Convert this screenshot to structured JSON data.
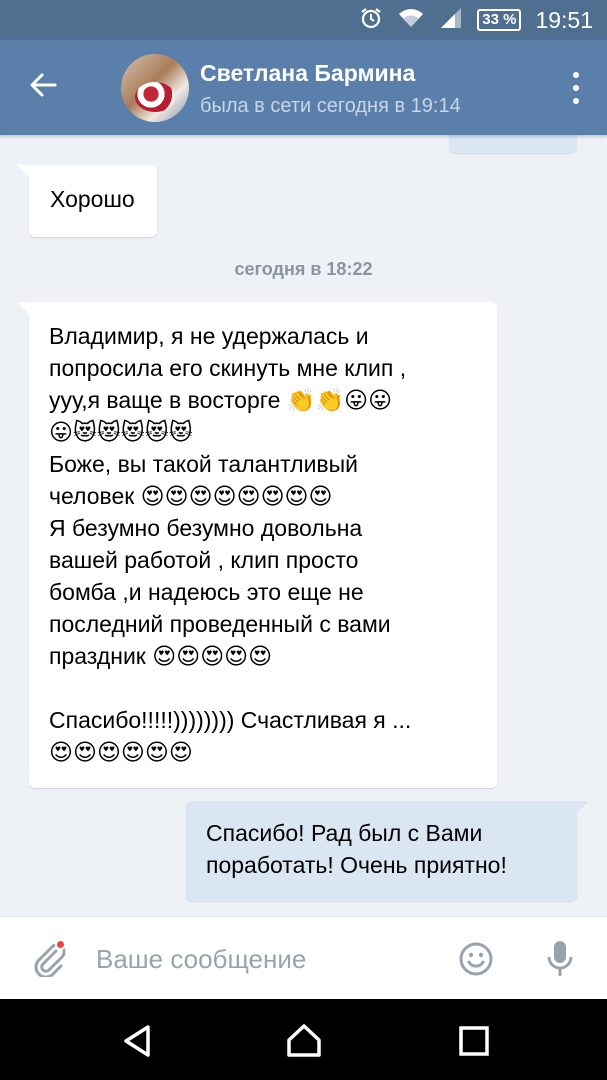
{
  "status_bar": {
    "alarm_icon": "alarm-icon",
    "wifi_icon": "wifi-icon",
    "signal_icon": "signal-icon",
    "battery_percent": "33 %",
    "time": "19:51"
  },
  "header": {
    "contact_name": "Светлана Бармина",
    "contact_status": "была в сети сегодня в 19:14",
    "colors": {
      "header_bg": "#5a7fab",
      "status_bar_bg": "#4f6f91"
    }
  },
  "chat": {
    "date_separator": "сегодня в 18:22",
    "messages": [
      {
        "direction": "in",
        "text": "Хорошо"
      },
      {
        "direction": "in",
        "text": "Владимир, я не удержалась и\nпопросила его скинуть мне клип ,\nууу,я ваще в восторге 👏👏😛😛\n😛😻😻😻😻😻\nБоже, вы такой талантливый\nчеловек 😍😍😍😍😍😍😍😍\nЯ безумно безумно довольна\nвашей работой , клип просто\nбомба ,и надеюсь это еще не\nпоследний проведенный с вами\nпраздник 😍😍😍😍😍\n\nСпасибо!!!!!)))))))) Счастливая я ...\n😍😍😍😍😍😍"
      },
      {
        "direction": "out",
        "text": "Спасибо! Рад был с Вами\nпоработать! Очень приятно!"
      }
    ],
    "colors": {
      "incoming_bg": "#ffffff",
      "outgoing_bg": "#dbe6f3",
      "chat_bg": "#eef1f5"
    }
  },
  "input_bar": {
    "placeholder": "Ваше сообщение",
    "attach_icon": "paperclip-icon",
    "emoji_icon": "smile-icon",
    "mic_icon": "microphone-icon"
  },
  "nav_bar": {
    "back_icon": "triangle-back-icon",
    "home_icon": "home-icon",
    "recents_icon": "square-recents-icon"
  }
}
